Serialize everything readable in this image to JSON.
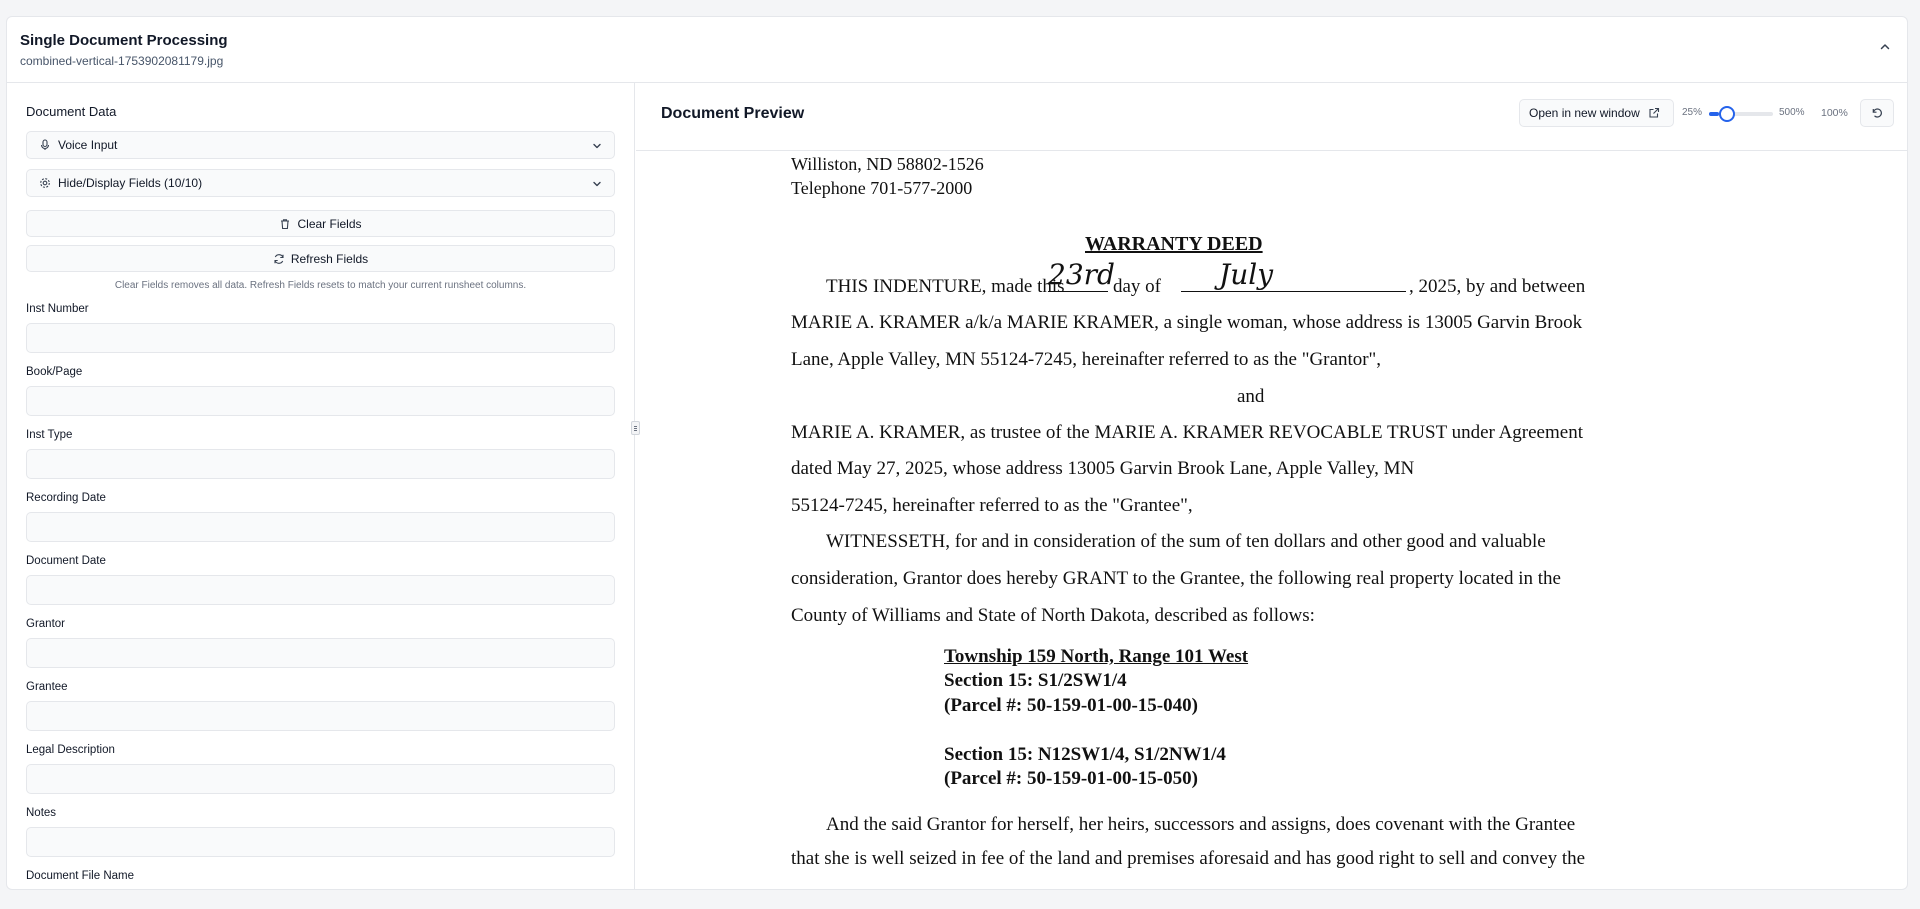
{
  "header": {
    "title": "Single Document Processing",
    "filename": "combined-vertical-1753902081179.jpg"
  },
  "left": {
    "section_title": "Document Data",
    "voice_input_label": "Voice Input",
    "fields_toggle_label": "Hide/Display Fields (10/10)",
    "clear_button": "Clear Fields",
    "refresh_button": "Refresh Fields",
    "hint": "Clear Fields removes all data. Refresh Fields resets to match your current runsheet columns.",
    "fields": [
      {
        "label": "Inst Number",
        "value": ""
      },
      {
        "label": "Book/Page",
        "value": ""
      },
      {
        "label": "Inst Type",
        "value": ""
      },
      {
        "label": "Recording Date",
        "value": ""
      },
      {
        "label": "Document Date",
        "value": ""
      },
      {
        "label": "Grantor",
        "value": ""
      },
      {
        "label": "Grantee",
        "value": ""
      },
      {
        "label": "Legal Description",
        "value": ""
      },
      {
        "label": "Notes",
        "value": ""
      },
      {
        "label": "Document File Name",
        "value": ""
      }
    ]
  },
  "preview": {
    "title": "Document Preview",
    "open_new_window": "Open in new window",
    "zoom_min": "25%",
    "zoom_max": "500%",
    "zoom_current": "100%",
    "zoom_level_fraction": 0.16
  },
  "document": {
    "addr1": "Williston, ND 58802-1526",
    "addr2": "Telephone 701-577-2000",
    "heading": "WARRANTY DEED",
    "indenture_a": "THIS INDENTURE, made this",
    "hw_day": "23rd",
    "indenture_b": "day of",
    "hw_month": "July",
    "indenture_c": ", 2025, by and between",
    "p1_l2": "MARIE A. KRAMER a/k/a MARIE KRAMER, a single woman, whose address is 13005 Garvin Brook",
    "p1_l3": "Lane, Apple Valley, MN 55124-7245, hereinafter referred to as the \"Grantor\",",
    "and": "and",
    "p2_l1": "MARIE A. KRAMER, as trustee of the MARIE A. KRAMER REVOCABLE TRUST under Agreement",
    "p2_l2": "dated May 27, 2025, whose address 13005 Garvin Brook Lane, Apple Valley, MN",
    "p2_l3": "55124-7245, hereinafter referred to as the \"Grantee\",",
    "p3_l1": "WITNESSETH, for and in consideration of the sum of ten dollars and other good and valuable",
    "p3_l2": "consideration, Grantor does hereby GRANT to the Grantee, the following real property located in the",
    "p3_l3": "County of Williams and State of North Dakota, described as follows:",
    "legal1": "Township 159 North, Range 101 West",
    "legal2": "Section 15: S1/2SW1/4",
    "legal3": "(Parcel #: 50-159-01-00-15-040)",
    "legal4": "Section 15: N12SW1/4, S1/2NW1/4",
    "legal5": "(Parcel #: 50-159-01-00-15-050)",
    "p4_l1": "And the said Grantor for herself, her heirs, successors and assigns, does covenant with the Grantee",
    "p4_l2": "that she is well seized in fee of the land and premises aforesaid and has good right to sell and convey the"
  }
}
